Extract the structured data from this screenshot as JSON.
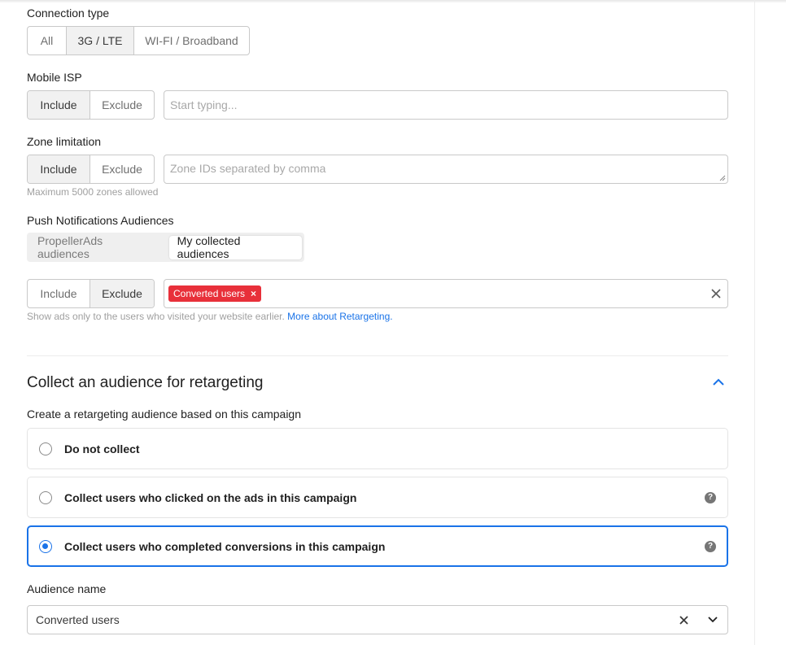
{
  "connection_type": {
    "label": "Connection type",
    "options": [
      "All",
      "3G / LTE",
      "WI-FI / Broadband"
    ],
    "selected": "3G / LTE"
  },
  "mobile_isp": {
    "label": "Mobile ISP",
    "include": "Include",
    "exclude": "Exclude",
    "selected": "Include",
    "placeholder": "Start typing..."
  },
  "zone_limitation": {
    "label": "Zone limitation",
    "include": "Include",
    "exclude": "Exclude",
    "selected": "Include",
    "placeholder": "Zone IDs separated by comma",
    "hint": "Maximum 5000 zones allowed"
  },
  "push_audiences": {
    "label": "Push Notifications Audiences",
    "tabs": [
      "PropellerAds audiences",
      "My collected audiences"
    ],
    "active_tab": "My collected audiences",
    "include": "Include",
    "exclude": "Exclude",
    "selected": "Exclude",
    "tag": "Converted users",
    "hint_text": "Show ads only to the users who visited your website earlier.",
    "hint_link": "More about Retargeting."
  },
  "retargeting": {
    "title": "Collect an audience for retargeting",
    "subtitle": "Create a retargeting audience based on this campaign",
    "options": [
      {
        "label": "Do not collect",
        "selected": false,
        "help": false
      },
      {
        "label": "Collect users who clicked on the ads in this campaign",
        "selected": false,
        "help": true
      },
      {
        "label": "Collect users who completed conversions in this campaign",
        "selected": true,
        "help": true
      }
    ],
    "audience_name_label": "Audience name",
    "audience_name_value": "Converted users"
  },
  "colors": {
    "accent": "#1a73e8",
    "tag": "#e8303a"
  }
}
